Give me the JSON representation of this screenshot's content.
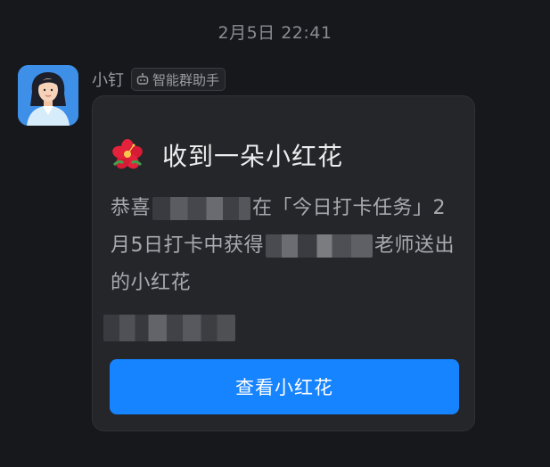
{
  "chat": {
    "timestamp": "2月5日 22:41"
  },
  "message": {
    "sender_name": "小钉",
    "bot_tag": {
      "icon": "robot-icon",
      "label": "智能群助手"
    },
    "avatar_icon": "woman-avatar",
    "card": {
      "icon": "red-flower-icon",
      "title": "收到一朵小红花",
      "body": {
        "line1_prefix": "恭喜",
        "line1_suffix": "在「今日打卡任务」2",
        "line2_prefix": "月5日打卡中获得",
        "line2_suffix": "老师送出",
        "line3": "的小红花"
      },
      "button_label": "查看小红花"
    }
  },
  "colors": {
    "background": "#17181c",
    "card": "#252629",
    "primary_button": "#1683ff",
    "flower_red": "#e4223b"
  }
}
